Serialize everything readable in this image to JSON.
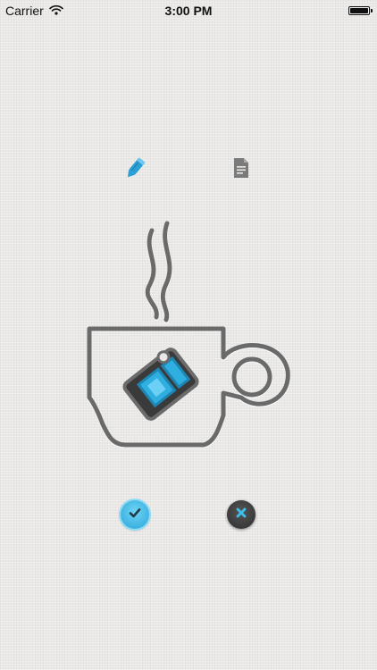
{
  "status_bar": {
    "carrier": "Carrier",
    "time": "3:00 PM",
    "icons": [
      "wifi-icon",
      "battery-icon"
    ]
  },
  "toolbar": {
    "icons": [
      "pencil-icon",
      "document-icon"
    ],
    "active_color": "#2b9ed6",
    "inactive_color": "#7a7a7a"
  },
  "illustration": {
    "icon": "coffee-cup-icon",
    "stroke_color": "#6b6b6b",
    "accent_color": "#2faee0"
  },
  "actions": {
    "icons": [
      "checkmark-icon",
      "close-icon"
    ],
    "confirm_color": "#2aa6d9",
    "cancel_color": "#333333",
    "cancel_icon_color": "#3cc0ef"
  }
}
